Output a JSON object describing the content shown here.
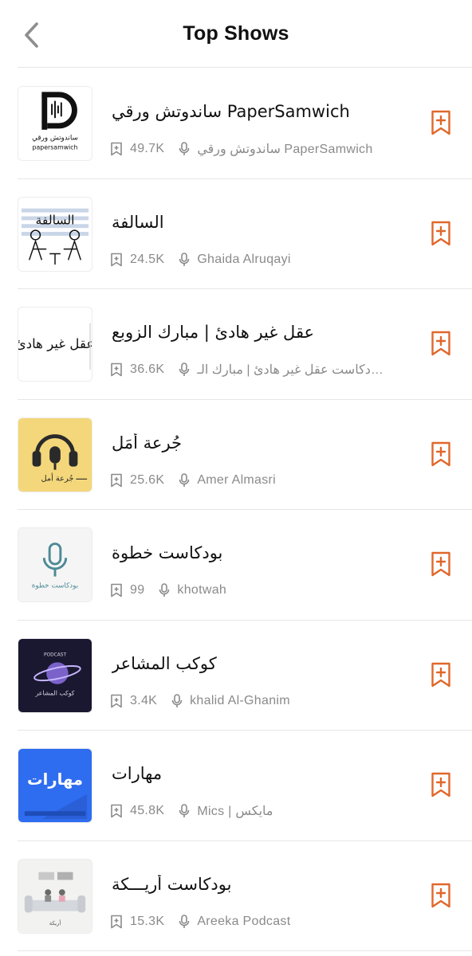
{
  "header": {
    "title": "Top Shows",
    "back_icon": "chevron-left-icon"
  },
  "colors": {
    "accent": "#e0672a",
    "meta_gray": "#8a8a8a",
    "divider": "#e6e6e6"
  },
  "shows": [
    {
      "title": "ساندوتش ورقي PaperSamwich",
      "subscribers": "49.7K",
      "author": "ساندوتش ورقي PaperSamwich",
      "cover_text": "papersamwich",
      "cover_text_ar": "ساندوتش ورقي"
    },
    {
      "title": "السالفة",
      "subscribers": "24.5K",
      "author": "Ghaida Alruqayi",
      "cover_text_ar": "السالفة"
    },
    {
      "title": "عقل غير هادئ | مبارك الزوبع",
      "subscribers": "36.6K",
      "author": "بودكاست عقل غير هادئ | مبارك الـ...",
      "cover_text_ar": "عقل غير هادئ"
    },
    {
      "title": "جُرعة أمَل",
      "subscribers": "25.6K",
      "author": "Amer Almasri",
      "cover_text_ar": "جُرعة أمل"
    },
    {
      "title": "بودكاست خطوة",
      "subscribers": "99",
      "author": "khotwah",
      "cover_text_ar": "بودكاست خطوة"
    },
    {
      "title": "كوكب المشاعر",
      "subscribers": "3.4K",
      "author": "khalid Al-Ghanim",
      "cover_text": "PODCAST",
      "cover_text_ar": "كوكب المشاعر"
    },
    {
      "title": "مهارات",
      "subscribers": "45.8K",
      "author": "Mics | مايكس",
      "cover_text_ar": "مهارات"
    },
    {
      "title": "بودكاست أريـــكة",
      "subscribers": "15.3K",
      "author": "Areeka Podcast",
      "cover_text_ar": "أريكة"
    }
  ]
}
